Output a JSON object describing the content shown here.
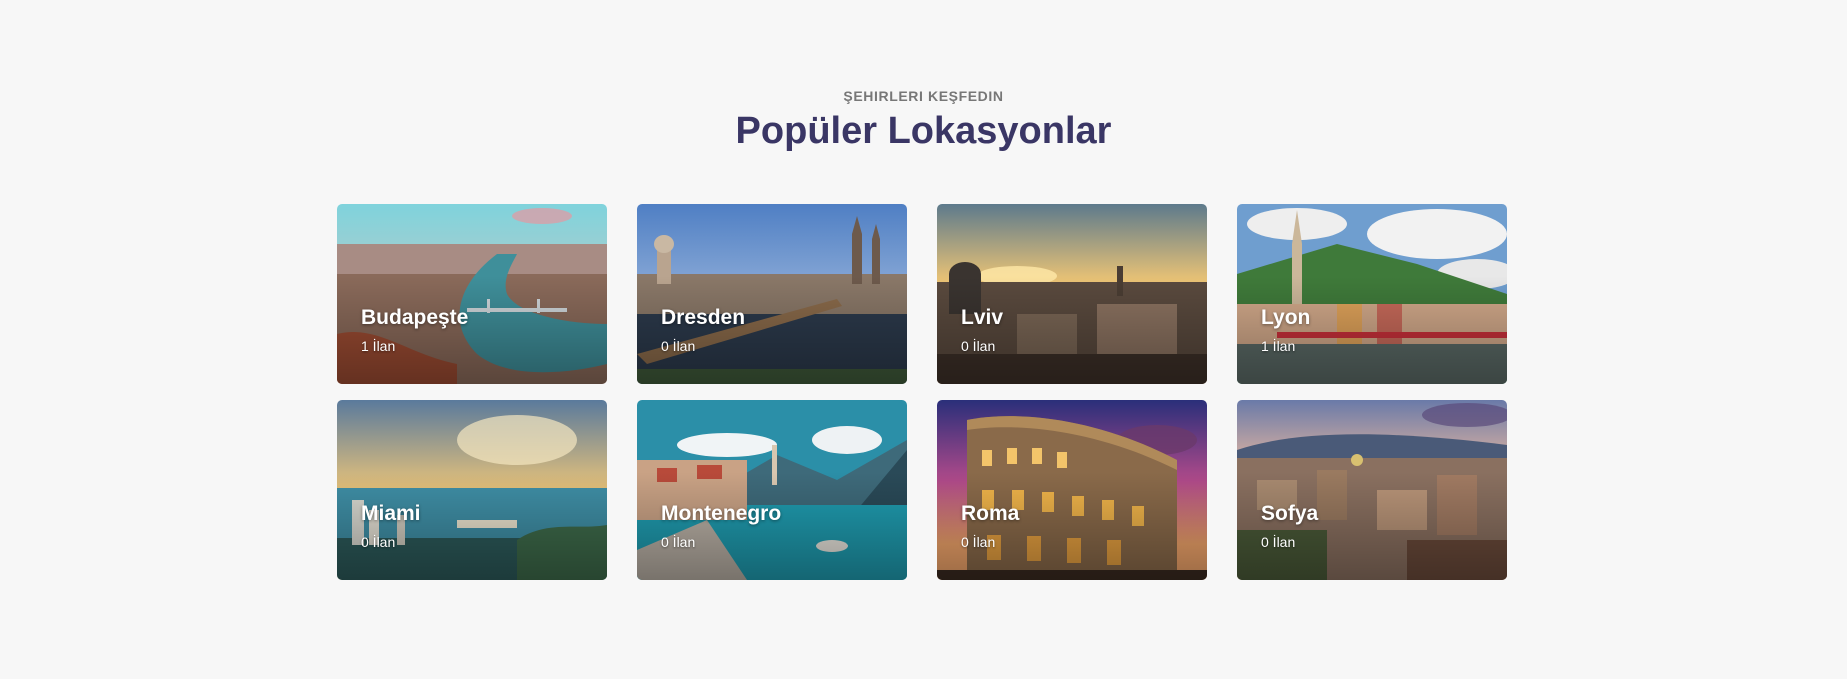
{
  "section": {
    "eyebrow": "ŞEHIRLERI KEŞFEDIN",
    "title": "Popüler Lokasyonlar"
  },
  "cities": [
    {
      "name": "Budapeşte",
      "count": "1 İlan"
    },
    {
      "name": "Dresden",
      "count": "0 İlan"
    },
    {
      "name": "Lviv",
      "count": "0 İlan"
    },
    {
      "name": "Lyon",
      "count": "1 İlan"
    },
    {
      "name": "Miami",
      "count": "0 İlan"
    },
    {
      "name": "Montenegro",
      "count": "0 İlan"
    },
    {
      "name": "Roma",
      "count": "0 İlan"
    },
    {
      "name": "Sofya",
      "count": "0 İlan"
    }
  ],
  "colors": {
    "title": "#3a3665",
    "eyebrow": "#777777",
    "background": "#f7f7f7"
  }
}
